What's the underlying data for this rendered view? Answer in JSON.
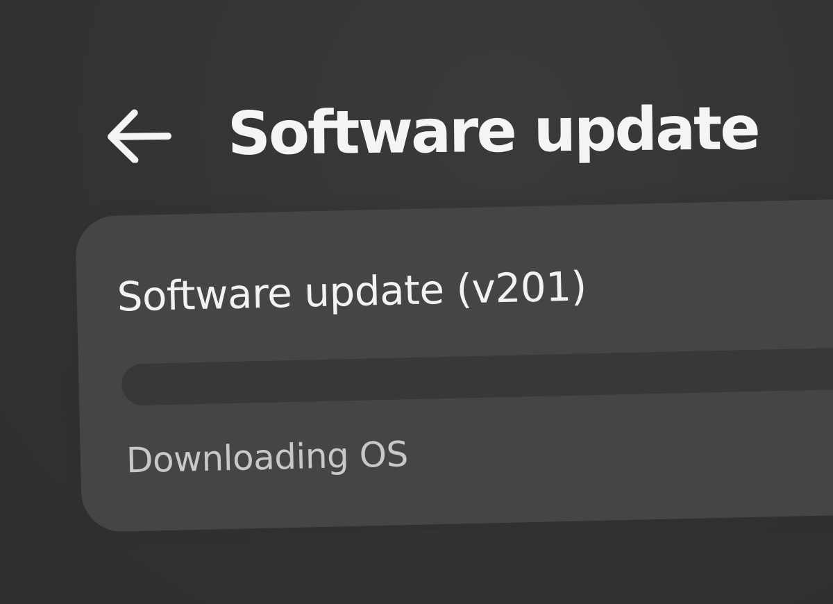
{
  "header": {
    "back_icon": "arrow-left-icon",
    "title": "Software update"
  },
  "update_card": {
    "title": "Software update (v201)",
    "progress": 0,
    "status": "Downloading OS"
  },
  "colors": {
    "background": "#333333",
    "card": "#454545",
    "track": "#383838",
    "title_text": "#f4f4f4",
    "status_text": "#c8c8c8"
  }
}
